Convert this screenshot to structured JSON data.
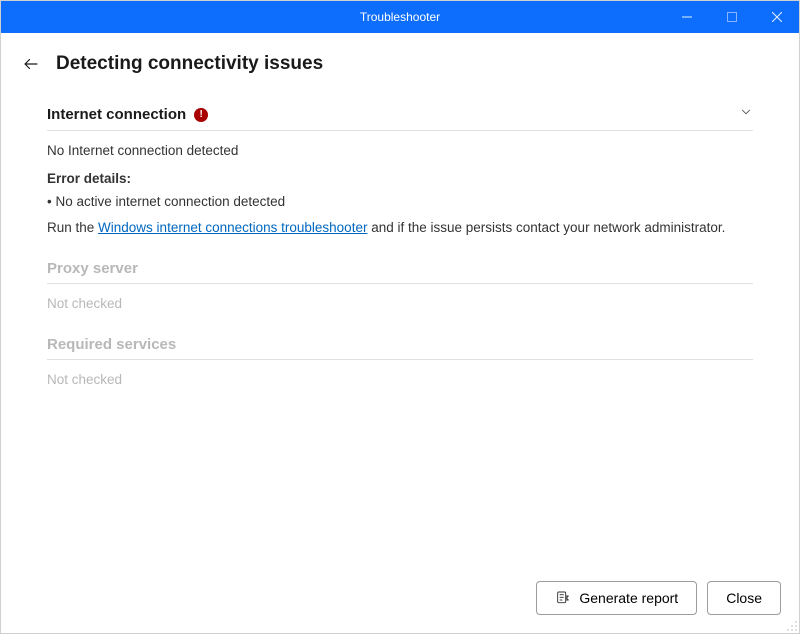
{
  "titlebar": {
    "title": "Troubleshooter"
  },
  "header": {
    "page_title": "Detecting connectivity issues"
  },
  "sections": {
    "internet": {
      "title": "Internet connection",
      "status": "No Internet connection detected",
      "error_label": "Error details:",
      "bullet": "• No active internet connection detected",
      "advice_prefix": "Run the ",
      "link_text": "Windows internet connections troubleshooter",
      "advice_suffix": " and if the issue persists contact your network administrator."
    },
    "proxy": {
      "title": "Proxy server",
      "status": "Not checked"
    },
    "services": {
      "title": "Required services",
      "status": "Not checked"
    }
  },
  "footer": {
    "generate_report": "Generate report",
    "close": "Close"
  }
}
